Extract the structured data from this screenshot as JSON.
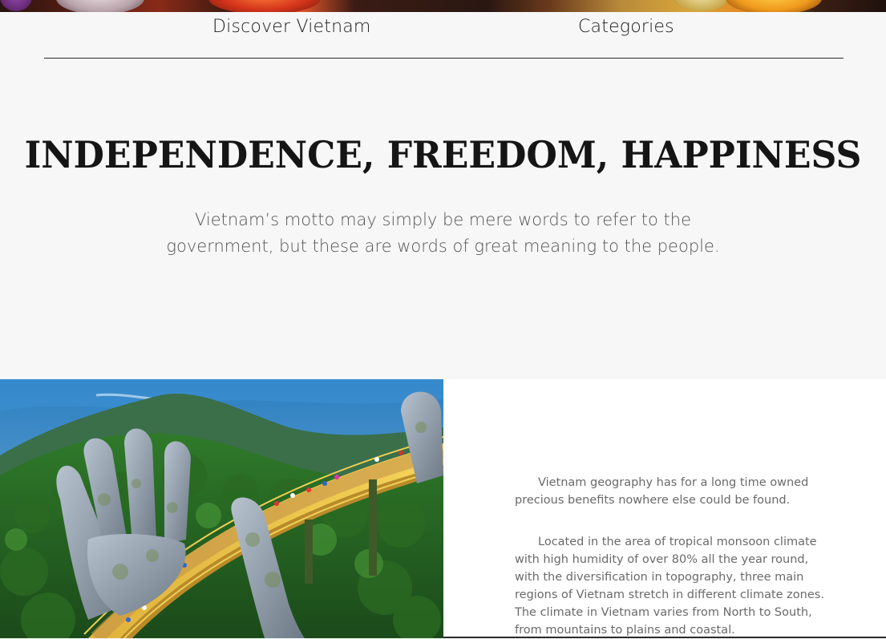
{
  "nav": {
    "discover_label": "Discover Vietnam",
    "categories_label": "Categories"
  },
  "hero": {
    "title": "INDEPENDENCE, FREEDOM, HAPPINESS",
    "subtitle": "Vietnam’s motto may simply be mere words to refer to the government, but these are words of great meaning to the people."
  },
  "images": {
    "top_banner": "lanterns-photo",
    "main_photo": "golden-bridge-hands-photo"
  },
  "content": {
    "paragraph_1": "Vietnam geography has for a long time owned precious benefits nowhere else could be found.",
    "paragraph_2": "Located in the area of tropical monsoon climate with high humidity of over 80% all the year round, with the diversification in topography, three main regions of Vietnam stretch in different climate zones. The climate in Vietnam varies from North to South, from mountains to plains and coastal."
  },
  "colors": {
    "page_background": "#f7f7f7",
    "panel_background": "#ffffff",
    "text_dark": "#151515",
    "text_muted": "#6a6a6a"
  }
}
